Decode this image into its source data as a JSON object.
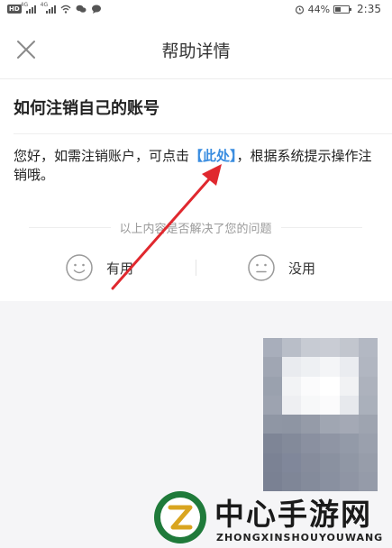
{
  "status_bar": {
    "hd_label": "HD",
    "network_1": "4G",
    "network_2": "4G",
    "battery_percent": "44%",
    "battery_level": 0.44,
    "time": "2:35"
  },
  "nav": {
    "close_icon": "close-icon",
    "title": "帮助详情"
  },
  "article": {
    "title": "如何注销自己的账号",
    "body_before": "您好，如需注销账户，可点击",
    "link_text": "【此处】",
    "body_after": "，根据系统提示操作注销哦。"
  },
  "feedback": {
    "prompt": "以上内容是否解决了您的问题",
    "useful_label": "有用",
    "useful_icon": "smile-face-icon",
    "useless_label": "没用",
    "useless_icon": "neutral-face-icon"
  },
  "annotation": {
    "arrow_color": "#e0282e"
  },
  "watermark": {
    "name": "中心手游网",
    "pinyin": "ZHONGXINSHOUYOUWANG"
  },
  "colors": {
    "link": "#3a8de0",
    "lower_bg": "#f5f5f7"
  }
}
